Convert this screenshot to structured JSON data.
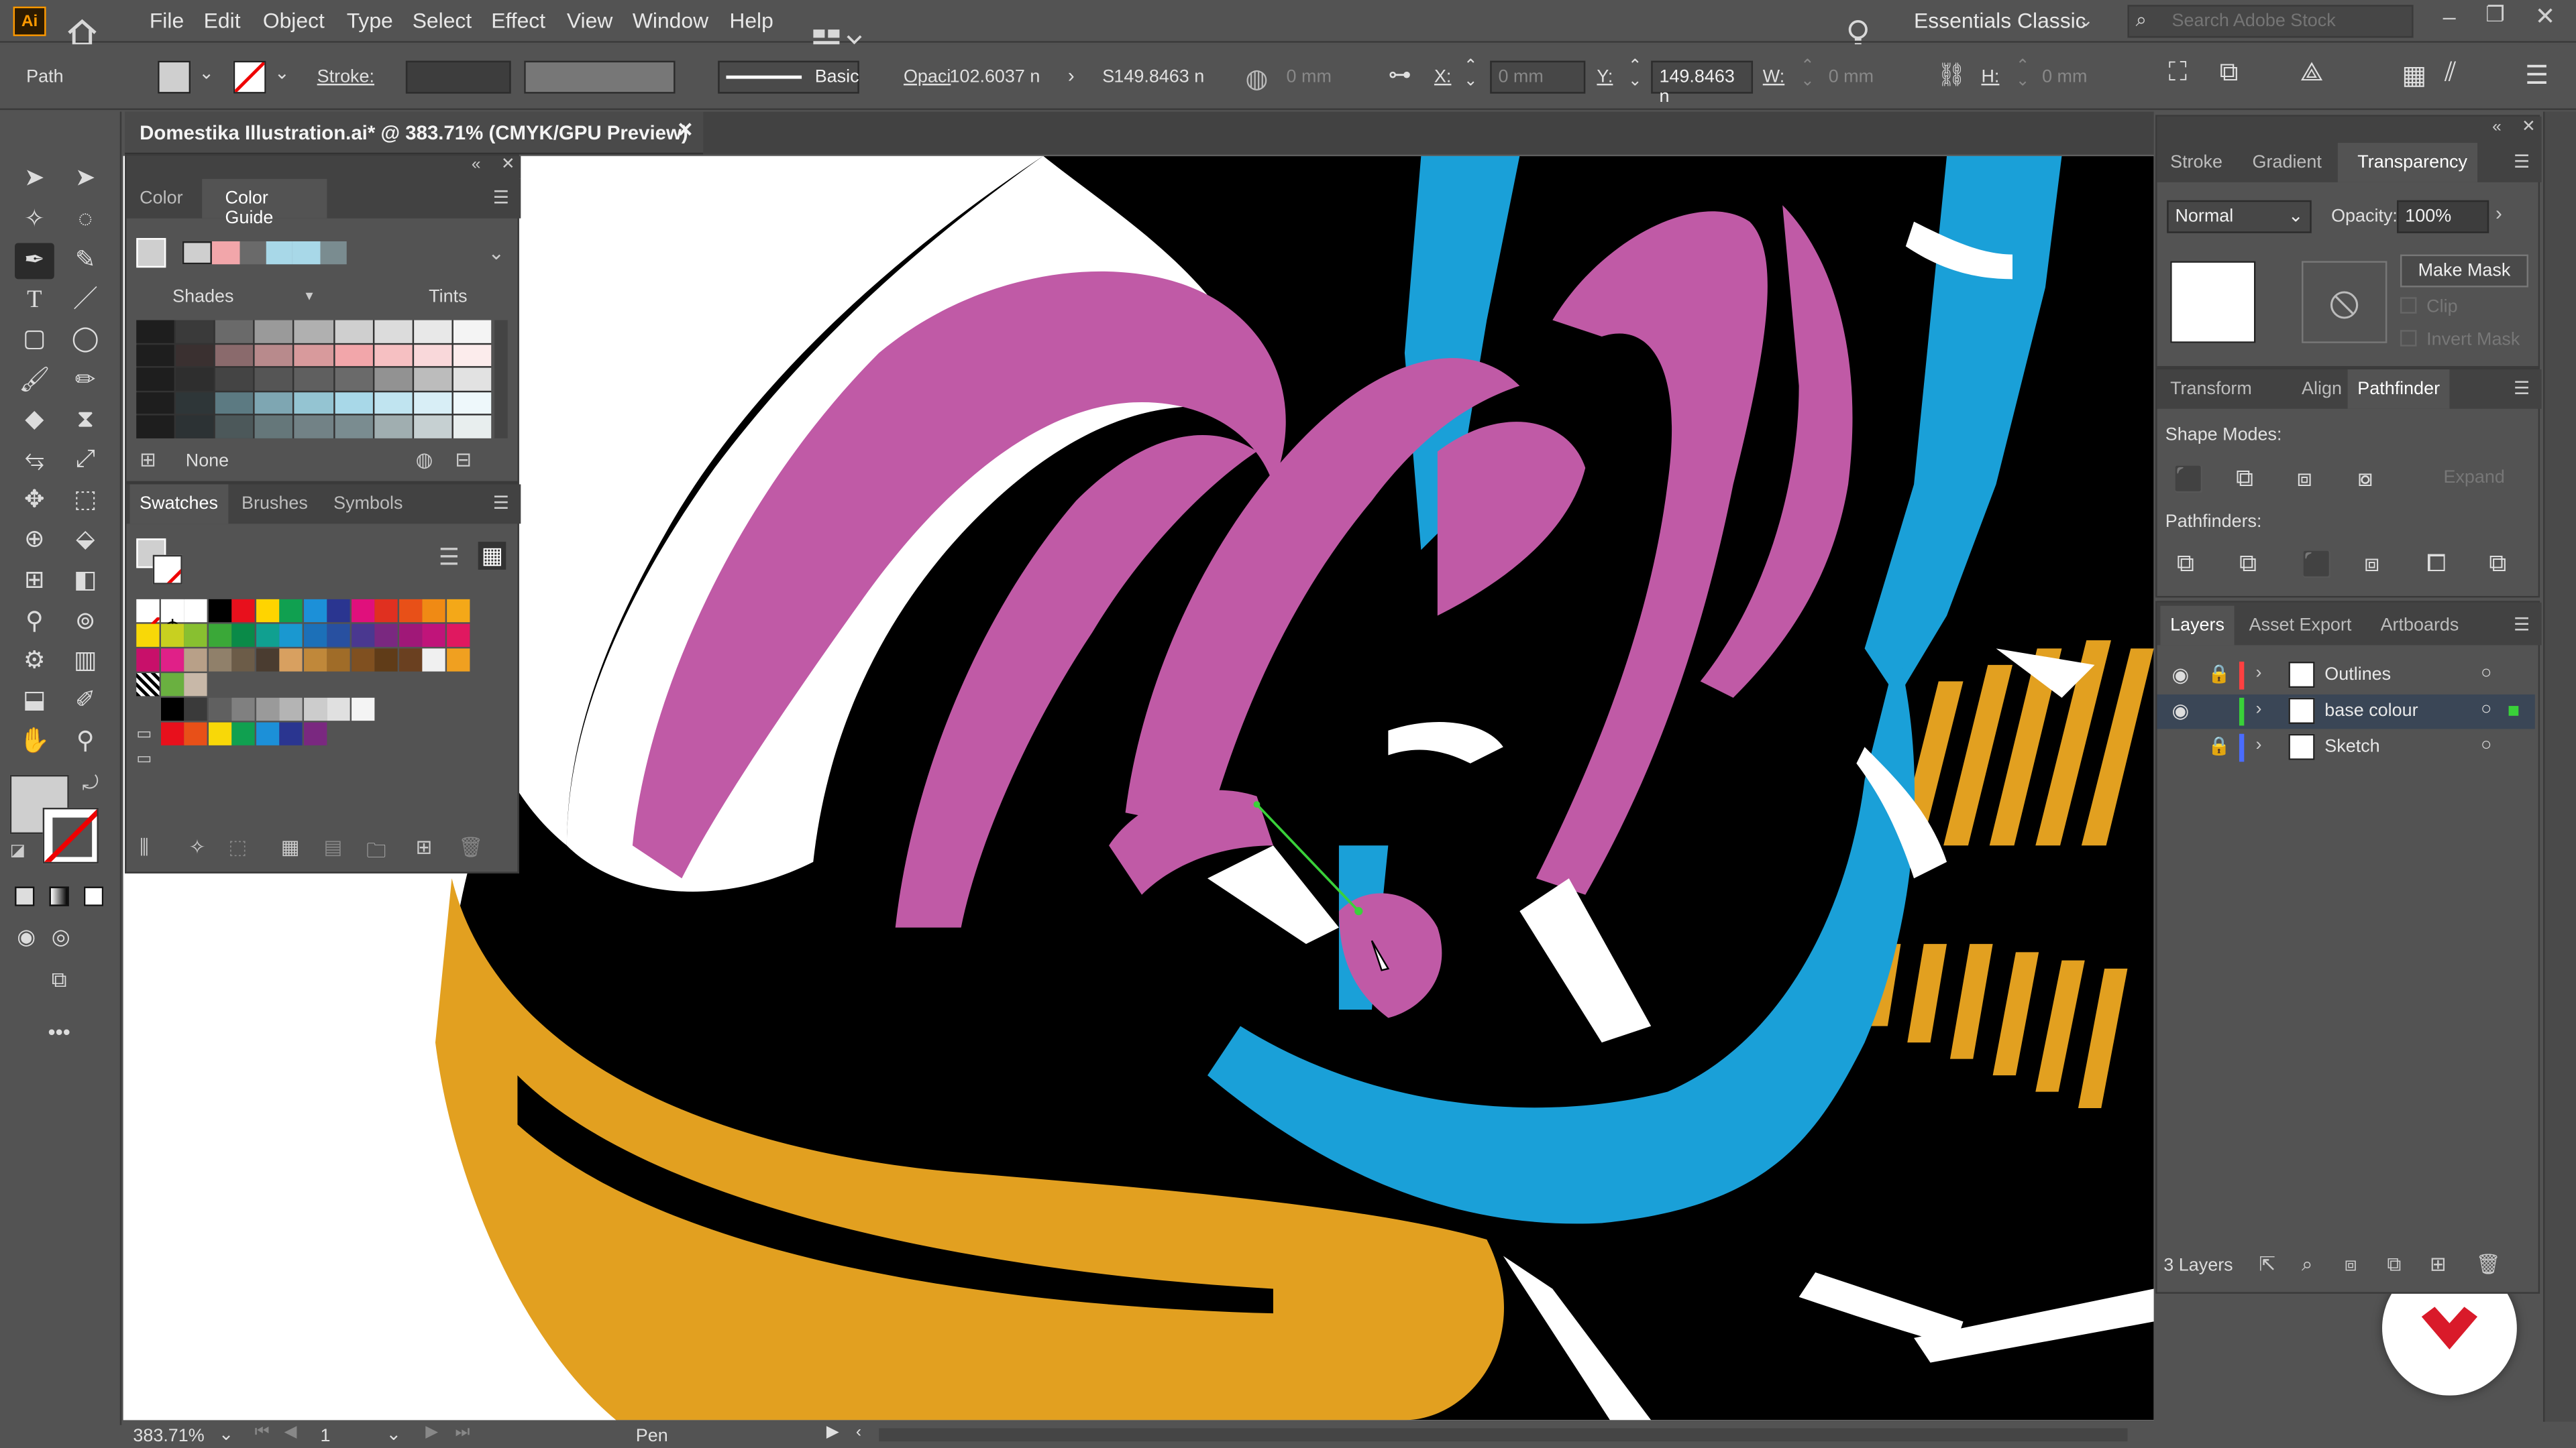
{
  "menubar": {
    "app_logo": "Ai",
    "items": [
      "File",
      "Edit",
      "Object",
      "Type",
      "Select",
      "Effect",
      "View",
      "Window",
      "Help"
    ],
    "workspace": "Essentials Classic",
    "search_placeholder": "Search Adobe Stock"
  },
  "controlbar": {
    "selection_type": "Path",
    "stroke_label": "Stroke:",
    "stroke_profile": "Basic",
    "opacity_label": "Opaci",
    "opacity_value": "102.6037 n",
    "style_label": "S",
    "style_value": "149.8463 n",
    "x_label": "X:",
    "x_value": "0 mm",
    "y_label": "Y:",
    "y_value": "149.8463 n",
    "w_label": "W:",
    "w_value": "0 mm",
    "h_label": "H:",
    "h_value": "0 mm",
    "ref_value": "0 mm"
  },
  "document": {
    "tab_title": "Domestika Illustration.ai* @ 383.71% (CMYK/GPU Preview)",
    "zoom": "383.71%",
    "artboard": "1",
    "status_tool": "Pen"
  },
  "color_panel": {
    "tabs": [
      "Color",
      "Color Guide"
    ],
    "shades_label": "Shades",
    "tints_label": "Tints",
    "none_label": "None"
  },
  "swatches_panel": {
    "tabs": [
      "Swatches",
      "Brushes",
      "Symbols"
    ]
  },
  "transparency_panel": {
    "tabs": [
      "Stroke",
      "Gradient",
      "Transparency"
    ],
    "blend_mode": "Normal",
    "opacity_label": "Opacity:",
    "opacity_value": "100%",
    "make_mask": "Make Mask",
    "clip": "Clip",
    "invert_mask": "Invert Mask"
  },
  "pathfinder_panel": {
    "tabs": [
      "Transform",
      "Align",
      "Pathfinder"
    ],
    "shape_modes_label": "Shape Modes:",
    "pathfinders_label": "Pathfinders:",
    "expand_label": "Expand"
  },
  "layers_panel": {
    "tabs": [
      "Layers",
      "Asset Export",
      "Artboards"
    ],
    "layers": [
      {
        "name": "Outlines",
        "color": "#ff4040"
      },
      {
        "name": "base colour",
        "color": "#39d139"
      },
      {
        "name": "Sketch",
        "color": "#4a6cff"
      }
    ],
    "count": "3 Layers"
  },
  "colors": {
    "pink": "#c05aa6",
    "blue": "#1aa0d8",
    "orange": "#e2a020",
    "black": "#000000"
  }
}
